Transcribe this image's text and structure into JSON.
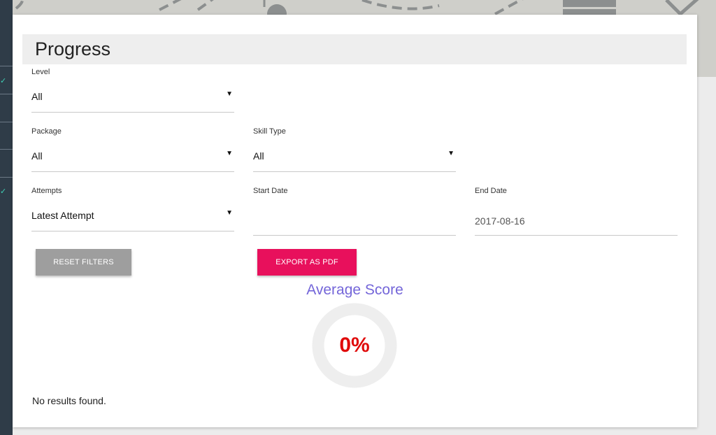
{
  "page": {
    "title": "Progress"
  },
  "filters": {
    "level": {
      "label": "Level",
      "value": "All"
    },
    "package": {
      "label": "Package",
      "value": "All"
    },
    "skill_type": {
      "label": "Skill Type",
      "value": "All"
    },
    "attempts": {
      "label": "Attempts",
      "value": "Latest Attempt"
    },
    "start_date": {
      "label": "Start Date",
      "value": ""
    },
    "end_date": {
      "label": "End Date",
      "value": "2017-08-16"
    }
  },
  "actions": {
    "reset_label": "RESET FILTERS",
    "export_label": "EXPORT AS PDF"
  },
  "average_score": {
    "title": "Average Score",
    "value_text": "0%",
    "fraction": 0
  },
  "results": {
    "empty_message": "No results found."
  },
  "colors": {
    "accent_export": "#e8105c",
    "reset_button": "#9e9e9e",
    "score_title": "#7466d9",
    "score_value": "#e00a0a",
    "gauge_track": "#eeeeee",
    "sidebar": "#2f3c48",
    "sidebar_check": "#3fd1b6"
  },
  "icons": {
    "dropdown": "caret-down-icon",
    "sidebar_check": "check-icon"
  }
}
